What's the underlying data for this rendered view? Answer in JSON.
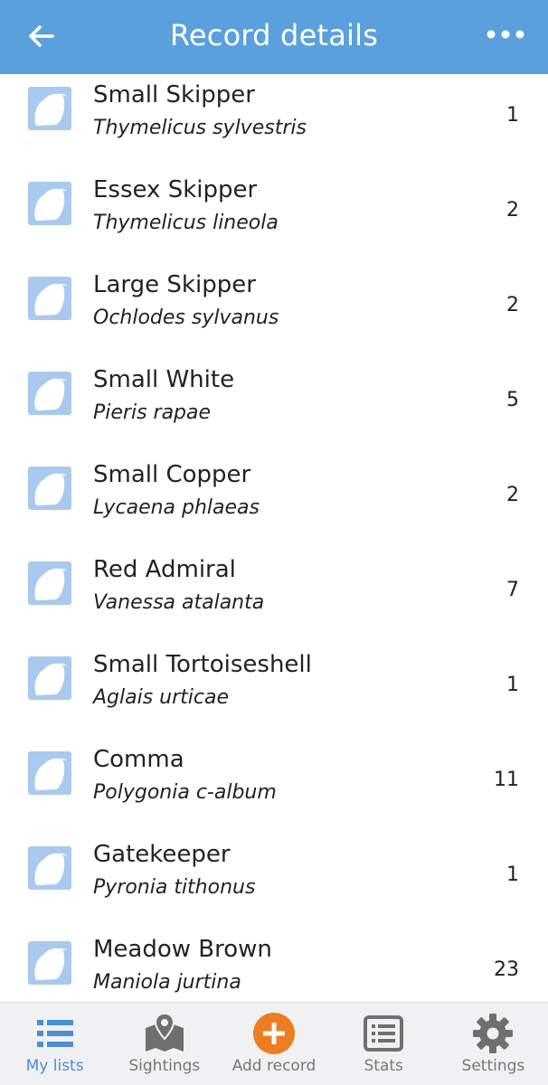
{
  "header": {
    "title": "Record details",
    "back_icon": "arrow-left-icon",
    "menu_icon": "more-horizontal-icon",
    "color": "#5aa0dc"
  },
  "records": [
    {
      "common": "Small Skipper",
      "latin": "Thymelicus sylvestris",
      "count": "1"
    },
    {
      "common": "Essex Skipper",
      "latin": "Thymelicus lineola",
      "count": "2"
    },
    {
      "common": "Large Skipper",
      "latin": "Ochlodes sylvanus",
      "count": "2"
    },
    {
      "common": "Small White",
      "latin": "Pieris rapae",
      "count": "5"
    },
    {
      "common": "Small Copper",
      "latin": "Lycaena phlaeas",
      "count": "2"
    },
    {
      "common": "Red Admiral",
      "latin": "Vanessa atalanta",
      "count": "7"
    },
    {
      "common": "Small Tortoiseshell",
      "latin": "Aglais urticae",
      "count": "1"
    },
    {
      "common": "Comma",
      "latin": "Polygonia c-album",
      "count": "11"
    },
    {
      "common": "Gatekeeper",
      "latin": "Pyronia tithonus",
      "count": "1"
    },
    {
      "common": "Meadow Brown",
      "latin": "Maniola jurtina",
      "count": "23"
    }
  ],
  "tabs": [
    {
      "label": "My lists",
      "icon": "list-icon",
      "active": true
    },
    {
      "label": "Sightings",
      "icon": "map-pin-icon",
      "active": false
    },
    {
      "label": "Add record",
      "icon": "add-circle-icon",
      "active": false
    },
    {
      "label": "Stats",
      "icon": "stats-list-icon",
      "active": false
    },
    {
      "label": "Settings",
      "icon": "gear-icon",
      "active": false
    }
  ],
  "colors": {
    "accent": "#5aa0dc",
    "thumb": "#a9c9ef",
    "add_button": "#ee7d22",
    "tab_active": "#4a8fd3",
    "tab_inactive": "#777777"
  }
}
